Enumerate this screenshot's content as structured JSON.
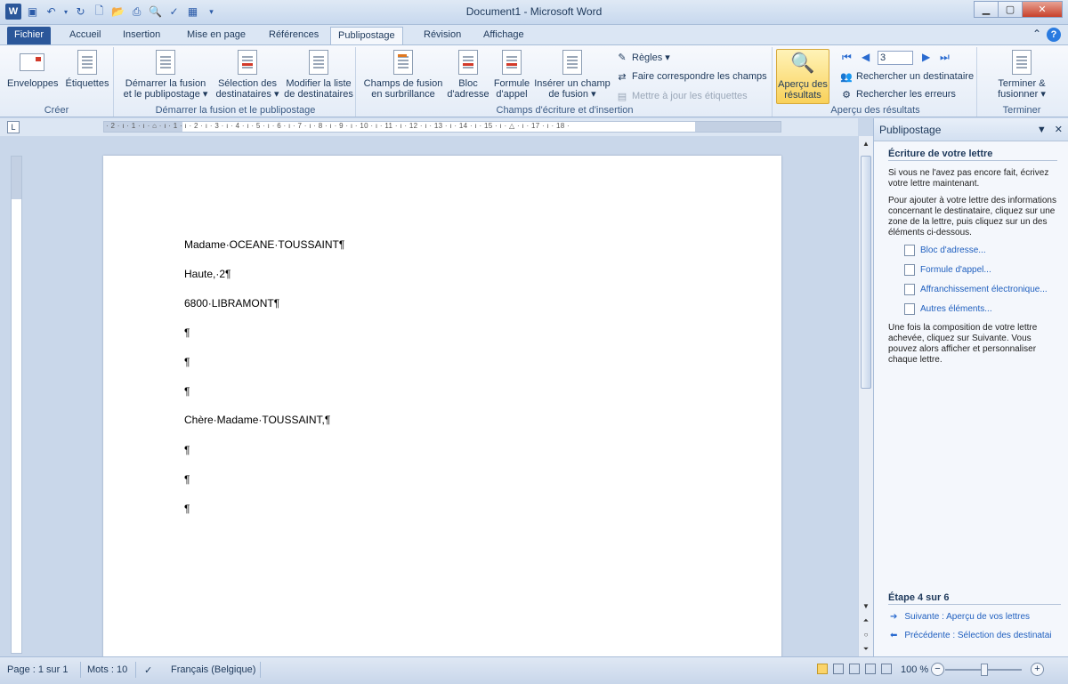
{
  "window": {
    "title": "Document1 - Microsoft Word"
  },
  "tabs": [
    "Fichier",
    "Accueil",
    "Insertion",
    "Mise en page",
    "Références",
    "Publipostage",
    "Révision",
    "Affichage"
  ],
  "active_tab": "Publipostage",
  "ribbon": {
    "groups": {
      "creer": "Créer",
      "demarrer": "Démarrer la fusion et le publipostage",
      "champs": "Champs d'écriture et d'insertion",
      "apercu": "Aperçu des résultats",
      "terminer": "Terminer"
    },
    "buttons": {
      "enveloppes": "Enveloppes",
      "etiquettes": "Étiquettes",
      "demarrer_l1": "Démarrer la fusion",
      "demarrer_l2": "et le publipostage ▾",
      "selection_l1": "Sélection des",
      "selection_l2": "destinataires ▾",
      "modifier_l1": "Modifier la liste",
      "modifier_l2": "de destinataires",
      "champs_fusion_l1": "Champs de fusion",
      "champs_fusion_l2": "en surbrillance",
      "bloc_l1": "Bloc",
      "bloc_l2": "d'adresse",
      "formule_l1": "Formule",
      "formule_l2": "d'appel",
      "inserer_l1": "Insérer un champ",
      "inserer_l2": "de fusion ▾",
      "regles": "Règles ▾",
      "faire_correspondre": "Faire correspondre les champs",
      "mettre_a_jour": "Mettre à jour les étiquettes",
      "apercu_l1": "Aperçu des",
      "apercu_l2": "résultats",
      "record_number": "3",
      "rechercher_destinataire": "Rechercher un destinataire",
      "rechercher_erreurs": "Rechercher les erreurs",
      "terminer_l1": "Terminer &",
      "terminer_l2": "fusionner ▾"
    }
  },
  "ruler": {
    "h_labels": "· 2 · ı · 1 · ı · ⌂ · ı · 1 · ı · 2 · ı · 3 · ı · 4 · ı · 5 · ı · 6 · ı · 7 · ı · 8 · ı · 9 · ı · 10 · ı · 11 · ı · 12 · ı · 13 · ı · 14 · ı · 15 · ı · △ · ı · 17 · ı · 18 ·",
    "corner": "L"
  },
  "document": {
    "paragraphs": [
      "Madame·OCEANE·TOUSSAINT¶",
      "Haute,·2¶",
      "6800·LIBRAMONT¶",
      "¶",
      "¶",
      "¶",
      "Chère·Madame·TOUSSAINT,¶",
      "¶",
      "¶",
      "¶"
    ]
  },
  "task_pane": {
    "title": "Publipostage",
    "heading": "Écriture de votre lettre",
    "p1": "Si vous ne l'avez pas encore fait, écrivez votre lettre maintenant.",
    "p2": "Pour ajouter à votre lettre des informations concernant le destinataire, cliquez sur une zone de la lettre, puis cliquez sur un des éléments ci-dessous.",
    "links": [
      "Bloc d'adresse...",
      "Formule d'appel...",
      "Affranchissement électronique...",
      "Autres éléments..."
    ],
    "p3": "Une fois la composition de votre lettre achevée, cliquez sur Suivante. Vous pouvez alors afficher et personnaliser chaque lettre.",
    "step": "Étape 4 sur 6",
    "next": "Suivante : Aperçu de vos lettres",
    "prev": "Précédente : Sélection des destinatai"
  },
  "status": {
    "page": "Page : 1 sur 1",
    "words": "Mots : 10",
    "language": "Français (Belgique)",
    "zoom": "100 %"
  }
}
